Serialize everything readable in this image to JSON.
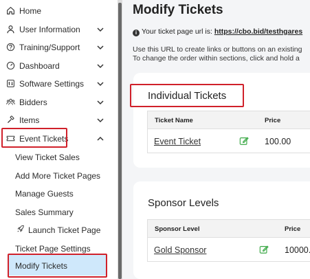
{
  "sidebar": {
    "items": [
      {
        "label": "Home",
        "icon": "home-icon"
      },
      {
        "label": "User Information",
        "icon": "user-icon"
      },
      {
        "label": "Training/Support",
        "icon": "help-circle-icon"
      },
      {
        "label": "Dashboard",
        "icon": "gauge-icon"
      },
      {
        "label": "Software Settings",
        "icon": "settings-panel-icon"
      },
      {
        "label": "Bidders",
        "icon": "people-icon"
      },
      {
        "label": "Items",
        "icon": "hammer-icon"
      },
      {
        "label": "Event Tickets",
        "icon": "ticket-icon"
      }
    ],
    "sub_items": [
      {
        "label": "View Ticket Sales"
      },
      {
        "label": "Add More Ticket Pages"
      },
      {
        "label": "Manage Guests"
      },
      {
        "label": "Sales Summary"
      },
      {
        "label": "Launch Ticket Page",
        "icon": "rocket-icon"
      },
      {
        "label": "Ticket Page Settings"
      },
      {
        "label": "Modify Tickets"
      }
    ]
  },
  "main": {
    "title": "Modify Tickets",
    "url_prefix": "Your ticket page url is: ",
    "url": "https://cbo.bid/testhgares",
    "help_line1": "Use this URL to create links or buttons on an existing",
    "help_line2": "To change the order within sections, click and hold a",
    "sections": [
      {
        "title": "Individual Tickets",
        "col_name": "Ticket Name",
        "col_price": "Price",
        "rows": [
          {
            "name": "Event Ticket",
            "price": "100.00"
          }
        ]
      },
      {
        "title": "Sponsor Levels",
        "col_name": "Sponsor Level",
        "col_price": "Price",
        "rows": [
          {
            "name": "Gold Sponsor",
            "price": "10000."
          }
        ]
      }
    ]
  },
  "colors": {
    "highlight": "#d0202a",
    "active_bg": "#cfe8fb",
    "edit_icon": "#3aa845"
  }
}
